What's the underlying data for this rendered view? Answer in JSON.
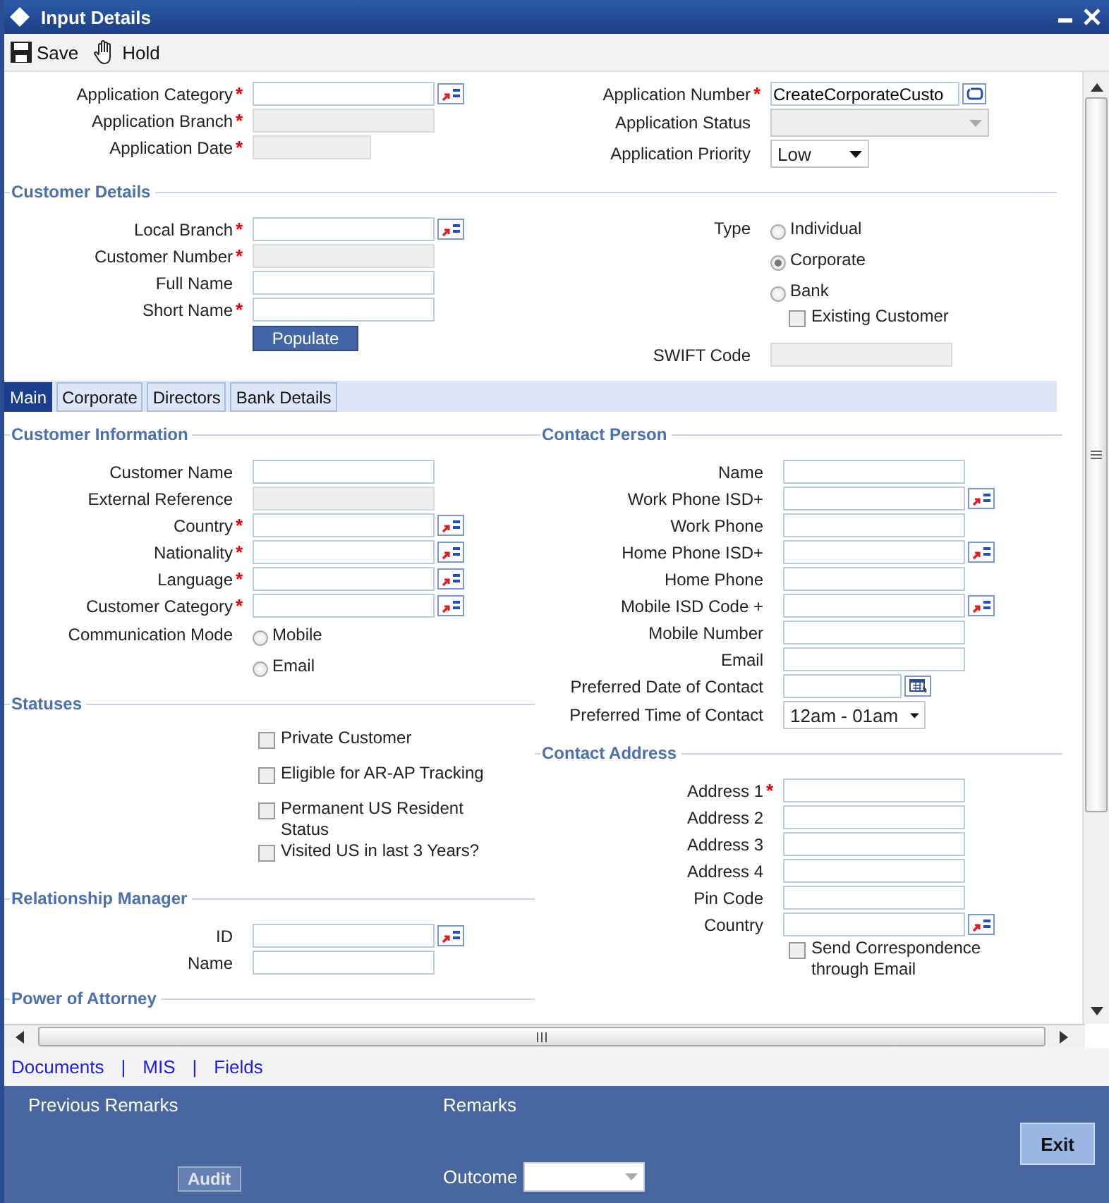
{
  "window": {
    "title": "Input Details"
  },
  "toolbar": [
    {
      "label": "Save",
      "kind": "save"
    },
    {
      "label": "Hold",
      "kind": "hold"
    }
  ],
  "application": {
    "left": [
      {
        "kind": "lookup",
        "label": "Application Category",
        "mark": "*"
      },
      {
        "kind": "readonly",
        "label": "Application Branch",
        "mark": "*"
      },
      {
        "kind": "short_readonly",
        "label": "Application Date",
        "mark": "*"
      }
    ],
    "right": [
      {
        "kind": "value_button",
        "label": "Application Number",
        "mark": "*",
        "value": "CreateCorporateCusto"
      },
      {
        "kind": "select",
        "label": "Application Status",
        "disabled": true
      },
      {
        "kind": "select",
        "label": "Application Priority",
        "value": "Low",
        "disabled": false
      }
    ]
  },
  "customer_details": {
    "title": "Customer Details",
    "left": [
      {
        "kind": "lookup",
        "label": "Local Branch",
        "mark": "*"
      },
      {
        "kind": "readonly",
        "label": "Customer Number",
        "mark": "*"
      },
      {
        "kind": "text",
        "label": "Full Name"
      },
      {
        "kind": "text",
        "label": "Short Name",
        "mark": "*"
      },
      {
        "kind": "button",
        "label": "Populate"
      }
    ],
    "right": [
      {
        "kind": "radio_group",
        "label": "Type",
        "options": [
          {
            "label": "Individual",
            "selected": false
          },
          {
            "label": "Corporate",
            "selected": true
          },
          {
            "label": "Bank",
            "selected": false
          }
        ]
      },
      {
        "kind": "checkbox",
        "label": "Existing Customer",
        "checked": false
      },
      {
        "kind": "readonly",
        "label": "SWIFT Code"
      }
    ]
  },
  "tabs": [
    {
      "label": "Main",
      "selected": true
    },
    {
      "label": "Corporate",
      "selected": false
    },
    {
      "label": "Directors",
      "selected": false
    },
    {
      "label": "Bank Details",
      "selected": false
    }
  ],
  "left_sections": [
    {
      "title": "Customer Information",
      "items": [
        {
          "kind": "text",
          "label": "Customer Name"
        },
        {
          "kind": "readonly",
          "label": "External Reference"
        },
        {
          "kind": "lookup",
          "label": "Country",
          "mark": "*"
        },
        {
          "kind": "lookup",
          "label": "Nationality",
          "mark": "*"
        },
        {
          "kind": "lookup",
          "label": "Language",
          "mark": "*"
        },
        {
          "kind": "lookup",
          "label": "Customer Category",
          "mark": "*"
        },
        {
          "kind": "radio_group",
          "label": "Communication Mode",
          "options": [
            {
              "label": "Mobile",
              "selected": false
            },
            {
              "label": "Email",
              "selected": false
            }
          ]
        }
      ]
    },
    {
      "title": "Statuses",
      "items": [
        {
          "kind": "checkbox",
          "label": "Private Customer",
          "checked": false
        },
        {
          "kind": "checkbox",
          "label": "Eligible for AR-AP Tracking",
          "checked": false
        },
        {
          "kind": "checkbox",
          "label": "Permanent US Resident Status",
          "checked": false
        },
        {
          "kind": "checkbox",
          "label": "Visited US in last 3 Years?",
          "checked": false
        }
      ]
    },
    {
      "title": "Relationship Manager",
      "items": [
        {
          "kind": "lookup",
          "label": "ID"
        },
        {
          "kind": "text",
          "label": "Name"
        }
      ]
    },
    {
      "title": "Power of Attorney"
    }
  ],
  "right_sections": [
    {
      "title": "Contact Person",
      "items": [
        {
          "kind": "text",
          "label": "Name"
        },
        {
          "kind": "lookup",
          "label": "Work Phone ISD+"
        },
        {
          "kind": "text",
          "label": "Work Phone"
        },
        {
          "kind": "lookup",
          "label": "Home Phone ISD+"
        },
        {
          "kind": "text",
          "label": "Home Phone"
        },
        {
          "kind": "lookup",
          "label": "Mobile ISD Code +"
        },
        {
          "kind": "text",
          "label": "Mobile Number"
        },
        {
          "kind": "text",
          "label": "Email"
        },
        {
          "kind": "date",
          "label": "Preferred Date of Contact"
        },
        {
          "kind": "select",
          "label": "Preferred Time of Contact",
          "value": "12am - 01am",
          "disabled": false
        }
      ]
    },
    {
      "title": "Contact Address",
      "items": [
        {
          "kind": "text",
          "label": "Address 1",
          "mark": "*"
        },
        {
          "kind": "text",
          "label": "Address 2"
        },
        {
          "kind": "text",
          "label": "Address 3"
        },
        {
          "kind": "text",
          "label": "Address 4"
        },
        {
          "kind": "text",
          "label": "Pin Code"
        },
        {
          "kind": "lookup",
          "label": "Country"
        },
        {
          "kind": "checkbox",
          "label": "Send Correspondence through Email",
          "checked": false
        }
      ]
    }
  ],
  "links": [
    "Documents",
    "MIS",
    "Fields"
  ],
  "link_separators": [
    "|",
    "|"
  ],
  "footer": {
    "previous_remarks": "Previous Remarks",
    "remarks": "Remarks",
    "audit_button": "Audit",
    "outcome": {
      "label": "Outcome"
    },
    "exit_button": "Exit"
  }
}
